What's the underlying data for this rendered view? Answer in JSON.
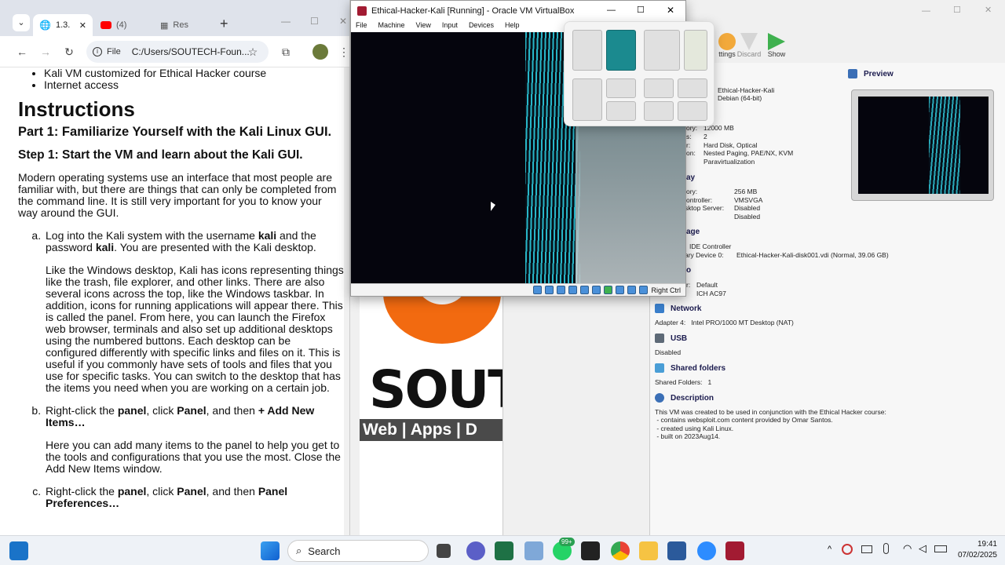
{
  "browser": {
    "tabs": [
      {
        "label": "1.3."
      },
      {
        "label": "(4)"
      },
      {
        "label": "Res"
      }
    ],
    "address": {
      "file_tag": "File",
      "url": "C:/Users/SOUTECH-Foun..."
    }
  },
  "doc": {
    "bullets": [
      "Kali VM customized for Ethical Hacker course",
      "Internet access"
    ],
    "h1": "Instructions",
    "part": "Part 1: Familiarize Yourself with the Kali Linux GUI.",
    "step": "Step 1: Start the VM and learn about the Kali GUI.",
    "intro": "Modern operating systems use an interface that most people are familiar with, but there are things that can only be completed from the command line. It is still very important for you to know your way around the GUI.",
    "items": {
      "a_text1": "Log into the Kali system with the username ",
      "a_user": "kali",
      "a_text2": " and the password ",
      "a_pass": "kali",
      "a_text3": ". You are presented with the Kali desktop.",
      "a_para": "Like the Windows desktop, Kali has icons representing things like the trash, file explorer, and other links. There are also several icons across the top, like the Windows taskbar. In addition, icons for running applications will appear there. This is called the panel. From here, you can launch the Firefox web browser, terminals and also set up additional desktops using the numbered buttons. Each desktop can be configured differently with specific links and files on it. This is useful if you commonly have sets of tools and files that you use for specific tasks. You can switch to the desktop that has the items you need when you are working on a certain job.",
      "b_text1": "Right-click the ",
      "b_panel": "panel",
      "b_text2": ", click ",
      "b_panel2": "Panel",
      "b_text3": ", and then ",
      "b_add": "+ Add New Items…",
      "b_para": "Here you can add many items to the panel to help you get to the tools and configurations that you use the most. Close the Add New Items window.",
      "c_text1": "Right-click the ",
      "c_panel": "panel",
      "c_text2": ", click ",
      "c_panel2": "Panel",
      "c_text3": ", and then ",
      "c_pref": "Panel Preferences…"
    }
  },
  "vm_window": {
    "title": "Ethical-Hacker-Kali [Running] - Oracle VM VirtualBox",
    "menu": [
      "File",
      "Machine",
      "View",
      "Input",
      "Devices",
      "Help"
    ],
    "status_key": "Right Ctrl"
  },
  "vbox_manager": {
    "toolbar": {
      "settings": "ttings",
      "discard": "Discard",
      "show": "Show"
    },
    "preview_label": "Preview",
    "general": {
      "name": "Ethical-Hacker-Kali",
      "os": "Debian (64-bit)"
    },
    "system": {
      "ram_label": "ory:",
      "ram": "12000 MB",
      "cpu_label": "s:",
      "cpu": "2",
      "boot_label": "r:",
      "boot": "Hard Disk, Optical",
      "accel_label": "on:",
      "accel": "Nested Paging, PAE/NX, KVM",
      "accel2": "Paravirtualization"
    },
    "display": {
      "title": "ay",
      "vram_label": "ory:",
      "vram": "256 MB",
      "ctrl_label": "ontroller:",
      "ctrl": "VMSVGA",
      "rds_label": "sktop Server:",
      "rds": "Disabled",
      "rec": "Disabled"
    },
    "storage": {
      "title": "age",
      "controller": "IDE Controller",
      "dev_label": "ary Device 0:",
      "dev": "Ethical-Hacker-Kali-disk001.vdi (Normal, 39.06 GB)"
    },
    "audio": {
      "title": "o",
      "host_label": "r:",
      "host": "Default",
      "ctrl": "ICH AC97"
    },
    "network": {
      "title": "Network",
      "line": "Adapter 4:   Intel PRO/1000 MT Desktop (NAT)"
    },
    "usb": {
      "title": "USB",
      "line": "Disabled"
    },
    "shared": {
      "title": "Shared folders",
      "line": "Shared Folders:   1"
    },
    "description": {
      "title": "Description",
      "lines": [
        "This VM was created to be used in conjunction with the Ethical Hacker course:",
        " - contains websploit.com content provided by Omar Santos.",
        " - created using Kali Linux.",
        " - built on 2023Aug14."
      ]
    }
  },
  "brand": {
    "big": "SOUT",
    "small": "Web | Apps | D"
  },
  "taskbar": {
    "search": "Search",
    "badge": "99+",
    "time": "19:41",
    "date": "07/02/2025"
  },
  "colors": {
    "vbox_green": "#3fb14f",
    "snap_accent": "#1b8a8f",
    "brand_orange": "#f26a10"
  }
}
